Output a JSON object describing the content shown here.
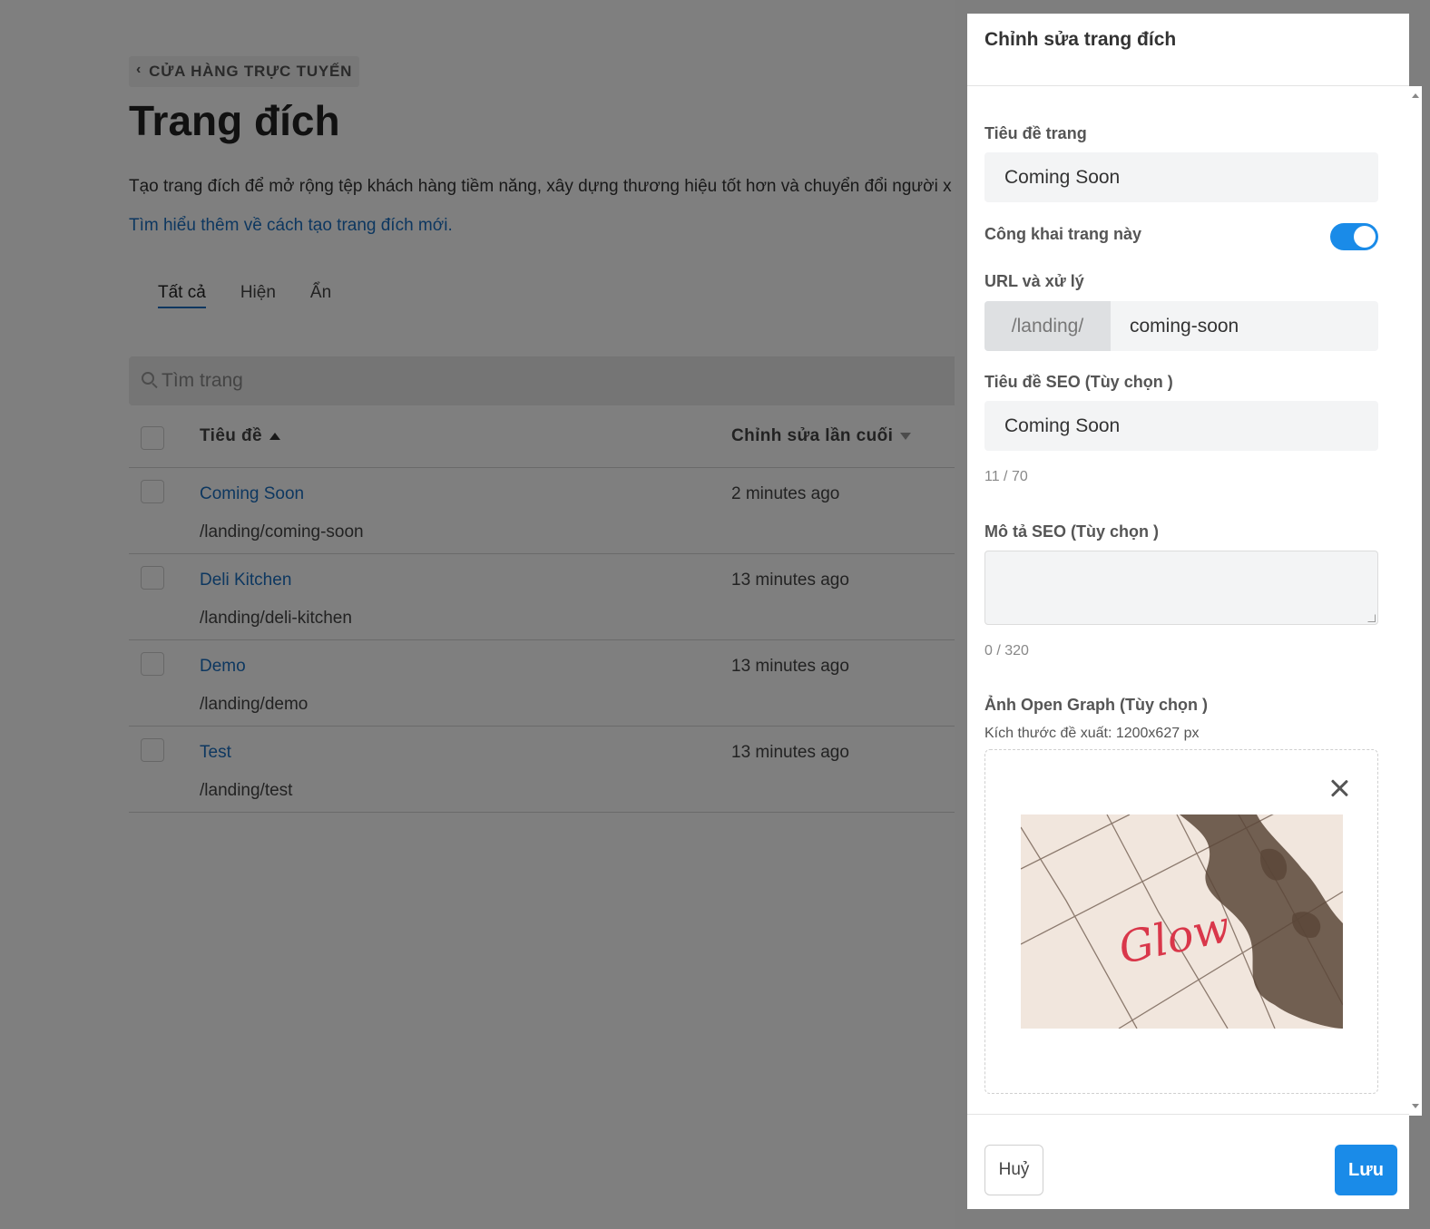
{
  "page": {
    "back_label": "CỬA HÀNG TRỰC TUYẾN",
    "title": "Trang đích",
    "description": "Tạo trang đích để mở rộng tệp khách hàng tiềm năng, xây dựng thương hiệu tốt hơn và chuyển đổi người x",
    "learn_more": "Tìm hiểu thêm về cách tạo trang đích mới.",
    "tabs": [
      {
        "label": "Tất cả",
        "active": true
      },
      {
        "label": "Hiện",
        "active": false
      },
      {
        "label": "Ẩn",
        "active": false
      }
    ],
    "search_placeholder": "Tìm trang",
    "table": {
      "col_title": "Tiêu đề",
      "col_edited": "Chỉnh sửa lần cuối",
      "rows": [
        {
          "title": "Coming Soon",
          "path": "/landing/coming-soon",
          "edited": "2 minutes ago"
        },
        {
          "title": "Deli Kitchen",
          "path": "/landing/deli-kitchen",
          "edited": "13 minutes ago"
        },
        {
          "title": "Demo",
          "path": "/landing/demo",
          "edited": "13 minutes ago"
        },
        {
          "title": "Test",
          "path": "/landing/test",
          "edited": "13 minutes ago"
        }
      ]
    }
  },
  "panel": {
    "title": "Chỉnh sửa trang đích",
    "page_title_label": "Tiêu đề trang",
    "page_title_value": "Coming Soon",
    "public_label": "Công khai trang này",
    "public_on": true,
    "url_label": "URL và xử lý",
    "url_prefix": "/landing/",
    "url_handle": "coming-soon",
    "seo_title_label": "Tiêu đề SEO (Tùy chọn )",
    "seo_title_value": "Coming Soon",
    "seo_title_counter": "11 / 70",
    "seo_desc_label": "Mô tả SEO (Tùy chọn )",
    "seo_desc_value": "",
    "seo_desc_counter": "0 / 320",
    "og_label": "Ảnh Open Graph (Tùy chọn )",
    "og_hint": "Kích thước đề xuất: 1200x627 px",
    "og_image_text": "Glow",
    "cancel_label": "Huỷ",
    "save_label": "Lưu"
  },
  "colors": {
    "accent": "#1a8be8",
    "link": "#1a6fc0"
  }
}
